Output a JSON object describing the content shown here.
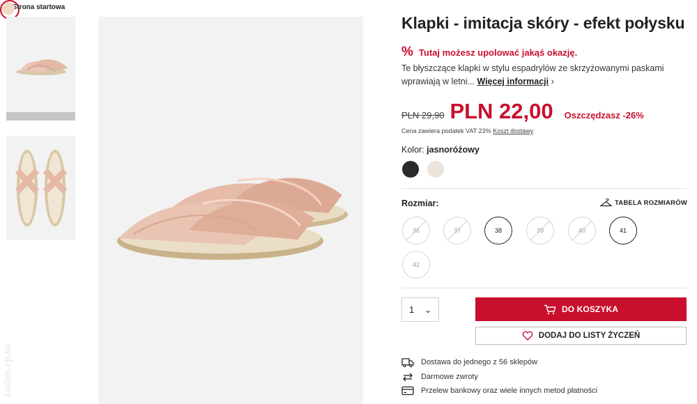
{
  "breadcrumb": {
    "label": "Strona startowa"
  },
  "product": {
    "title": "Klapki - imitacja skóry - efekt połysku",
    "promo_text": "Tutaj możesz upolować jakąś okazję.",
    "promo_icon": "percent-icon",
    "description": "Te błyszczące klapki w stylu espadrylów ze skrzyżowanymi paskami wprawiają w letni...",
    "more_info_label": "Więcej informacji"
  },
  "price": {
    "old": "PLN 29,90",
    "new": "PLN 22,00",
    "saving": "Oszczędzasz -26%",
    "vat_text": "Cena zawiera podatek VAT 23%",
    "shipping_link": "Koszt dostawy"
  },
  "color": {
    "label": "Kolor:",
    "selected": "jasnoróżowy",
    "swatches": [
      {
        "name": "black",
        "hex": "#2a2a2a"
      },
      {
        "name": "cream",
        "hex": "#ede4dc"
      },
      {
        "name": "jasnoróżowy",
        "hex": "#f4d9c6",
        "selected": true
      }
    ]
  },
  "size": {
    "label": "Rozmiar:",
    "table_label": "TABELA ROZMIARÓW",
    "options": [
      {
        "value": "36",
        "available": false
      },
      {
        "value": "37",
        "available": false
      },
      {
        "value": "38",
        "available": true
      },
      {
        "value": "39",
        "available": false
      },
      {
        "value": "40",
        "available": false
      },
      {
        "value": "41",
        "available": true
      },
      {
        "value": "42",
        "available": false
      }
    ]
  },
  "cart": {
    "quantity": "1",
    "add_label": "DO KOSZYKA",
    "wishlist_label": "DODAJ DO LISTY ŻYCZEŃ"
  },
  "info": [
    {
      "icon": "truck-icon",
      "text": "Dostawa do jednego z 56 sklepów"
    },
    {
      "icon": "return-arrows-icon",
      "text": "Darmowe zwroty"
    },
    {
      "icon": "credit-card-icon",
      "text": "Przelew bankowy oraz wiele innych metod płatności"
    }
  ],
  "watermark": "Ladies.cp.ua",
  "colors": {
    "accent": "#c8102e",
    "image_bg": "#f2f2f2"
  }
}
